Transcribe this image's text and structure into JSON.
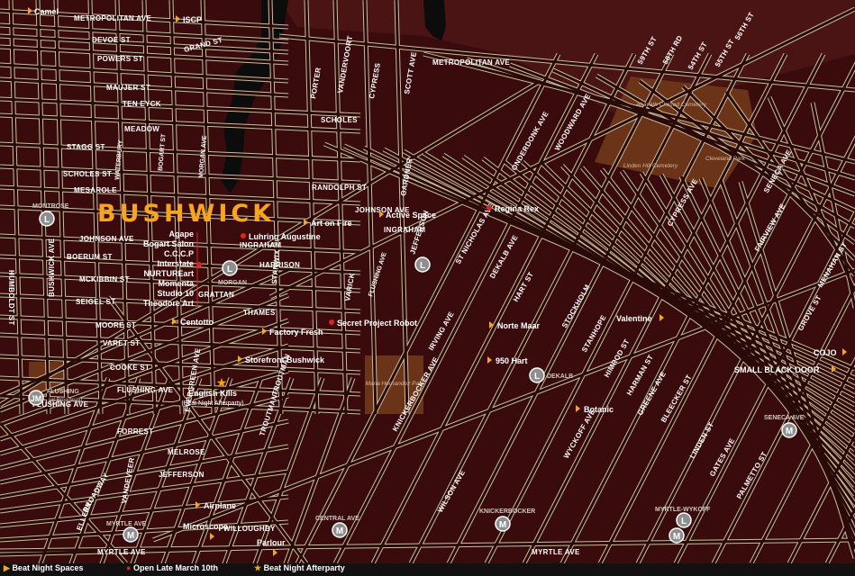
{
  "title": "BUSHWICK",
  "colors": {
    "background": "#4a1414",
    "block": "#3a0b0c",
    "street": "#c8bea0",
    "park": "#6b3418",
    "water": "#0c0c0c",
    "accent": "#f6a51f",
    "open_late": "#e0221f"
  },
  "streets": {
    "metropolitan_ave": "METROPOLITAN AVE",
    "metropolitan_ave_2": "METROPOLITAN AVE",
    "devoe_st": "DEVOE ST",
    "grand_st": "GRAND ST",
    "powers_st": "POWERS ST",
    "maujer_st": "MAUJER ST",
    "ten_eyck": "TEN EYCK",
    "meadow": "MEADOW",
    "stagg_st": "STAGG ST",
    "scholes_st": "SCHOLES ST",
    "scholes": "SCHOLES",
    "mesarole": "MESAROLE",
    "waterbury": "WATERBURY",
    "bogart_st": "BOGART ST",
    "morgan_ave": "MORGAN AVE",
    "randolph_st": "RANDOLPH ST",
    "johnson_ave": "JOHNSON AVE",
    "johnson_ave_2": "JOHNSON AVE",
    "ingraham": "INGRAHAM",
    "ingraham_2": "INGRAHAM",
    "boerum_st": "BOERUM ST",
    "harrison": "HARRISON",
    "mckibbin_st": "MCKIBBIN ST",
    "seigel_st": "SEIGEL ST",
    "grattan": "GRATTAN",
    "thames": "THAMES",
    "moore_st": "MOORE ST",
    "varet_st": "VARET ST",
    "cooke_st": "COOKE ST",
    "flushing_ave": "FLUSHING AVE",
    "flushing_ave_2": "FLUSHING AVE",
    "flushing_ave_3": "FLUSHING AVE",
    "forrest": "FORREST",
    "jefferson": "JEFFERSON",
    "jefferson_2": "JEFFERSON",
    "troutman": "TROUTMAN",
    "troutman_2": "TROUTMAN",
    "melrose": "MELROSE",
    "knickerbocker_ave": "KNICKERBOCKER AVE",
    "wilson_ave": "WILSON AVE",
    "central_ave": "CENTRAL AVE",
    "evergreen_ave": "EVERGREEN AVE",
    "bushwick_ave": "BUSHWICK AVE",
    "broadway": "BROADWAY",
    "myrtle_ave": "MYRTLE AVE",
    "myrtle_ave_2": "MYRTLE AVE",
    "willoughby": "WILLOUGHBY",
    "dekalb_ave": "DEKALB AVE",
    "hart_st": "HART ST",
    "stockholm": "STOCKHOLM",
    "stanhope": "STANHOPE",
    "himrod_st": "HIMROD ST",
    "harman_st": "HARMAN ST",
    "greene_ave": "GREENE AVE",
    "bleecker_st": "BLEECKER ST",
    "linden_st": "LINDEN ST",
    "gates_ave": "GATES AVE",
    "palmetto_st": "PALMETTO ST",
    "woodward_ave": "WOODWARD AVE",
    "onderdonk_ave": "ONDERDONK AVE",
    "seneca_ave": "SENECA AVE",
    "grove_st": "GROVE ST",
    "menahan_st": "MENAHAN ST",
    "cypress_ave": "CYPRESS AVE",
    "irving_ave": "IRVING AVE",
    "wyckoff_ave": "WYCKOFF AVE",
    "st_nicholas_ave": "ST NICHOLAS AVE",
    "stanwix": "STANWIX",
    "vandervoort": "VANDERVOORT",
    "porter": "PORTER",
    "varick": "VARICK",
    "scott_ave": "SCOTT AVE",
    "gardner": "GARDNER",
    "cypress": "CYPRESS",
    "flushing": "FLUSHING",
    "humboldt_st": "HUMBOLDT ST",
    "montrose": "MONTROSE",
    "n_56th_st": "56TH ST",
    "n_55th_st": "55TH ST",
    "n_54th_st": "54TH ST",
    "n_58th_rd": "58TH RD",
    "n_59th_st": "59TH ST",
    "fairview_ave": "FAIRVIEW AVE",
    "vandeveer": "VANDEVEER",
    "ellery": "ELLERY"
  },
  "parks": {
    "ahavath": "Ahavath Chased Cemetery",
    "linden_hill": "Linden Hill Cemetery",
    "cleveland": "Cleveland Park",
    "maria_hernandez": "Maria Hernandez Park"
  },
  "venues": {
    "camel": "Camel",
    "iscp": "ISCP",
    "agape": "Agape",
    "bogart_salon": "Bogart Salon",
    "cccp": "C.C.C.P",
    "interstate": "Interstate",
    "nurtureart": "NURTUREart",
    "momenta": "Momenta",
    "studio_10": "Studio 10",
    "theodore_art": "Theodore Art",
    "luhring": "Luhring Augustine",
    "art_on_fire": "Art on Fire",
    "active_space": "Active Space",
    "regina_rex": "Regina Rex",
    "centotto": "Centotto",
    "factory_fresh": "Factory Fresh",
    "secret_project": "Secret Project Robot",
    "norte_maar": "Norte Maar",
    "valentine": "Valentine",
    "nine50_hart": "950 Hart",
    "storefront": "Storefront Bushwick",
    "english_kills": "English Kills",
    "english_kills_note": "(Beat Night Afterparty)",
    "botanic": "Botanic",
    "cojo": "COJO",
    "small_black_door": "SMALL BLACK DOOR",
    "airplane": "Airplane",
    "microscope": "Microscope",
    "parlour": "Parlour"
  },
  "stations": {
    "montrose": "MONTROSE",
    "morgan": "MORGAN",
    "jefferson": "JEFFERSON",
    "dekalb": "DEKALB",
    "flushing": "FLUSHING",
    "flushing_sub": "(at Broadway)",
    "seneca": "SENECA AVE",
    "myrtle": "MYRTLE AVE",
    "central": "CENTRAL AVE",
    "knickerbocker": "KNICKERBOCKER",
    "myrtle_wyckoff": "MYRTLE-WYKOFF"
  },
  "legend": {
    "beat_night_spaces": "Beat Night Spaces",
    "open_late": "Open Late March 10th",
    "afterparty": "Beat Night Afterparty"
  }
}
